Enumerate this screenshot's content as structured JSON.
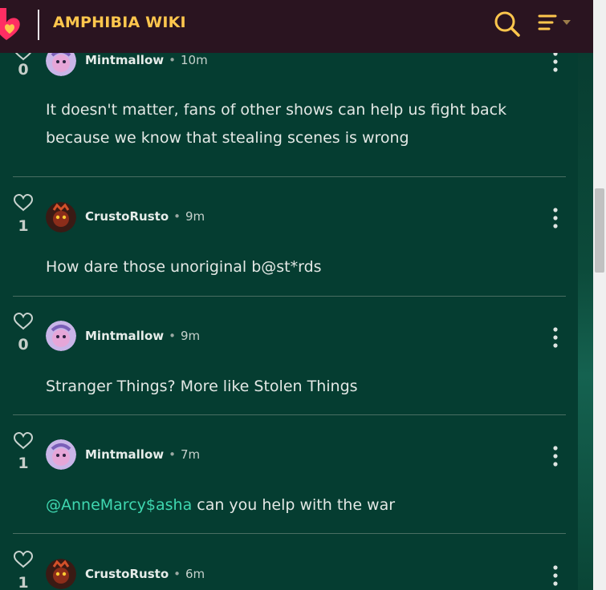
{
  "header": {
    "wiki_title": "AMPHIBIA WIKI",
    "logo_icon": "fandom-heart-logo-icon",
    "search_icon": "search-icon",
    "menu_icon": "menu-lines-icon",
    "accent": "#fdc64d",
    "bar_color": "#2a1420"
  },
  "feed": {
    "background": "#053d31",
    "mention_color": "#3fd7b0",
    "posts": [
      {
        "likes": "0",
        "user": "Mintmallow",
        "time": "10m",
        "avatar": "mintmallow-avatar",
        "text": "It doesn't matter, fans of other shows can help us fight back because we know that stealing scenes is wrong"
      },
      {
        "likes": "1",
        "user": "CrustoRusto",
        "time": "9m",
        "avatar": "crustorusto-avatar",
        "text": "How dare those unoriginal b@st*rds"
      },
      {
        "likes": "0",
        "user": "Mintmallow",
        "time": "9m",
        "avatar": "mintmallow-avatar",
        "text": "Stranger Things? More like Stolen Things"
      },
      {
        "likes": "1",
        "user": "Mintmallow",
        "time": "7m",
        "avatar": "mintmallow-avatar",
        "mention": "@AnneMarcy$asha",
        "text": " can you help with the war"
      },
      {
        "likes": "1",
        "user": "CrustoRusto",
        "time": "6m",
        "avatar": "crustorusto-avatar",
        "text": ""
      }
    ]
  }
}
